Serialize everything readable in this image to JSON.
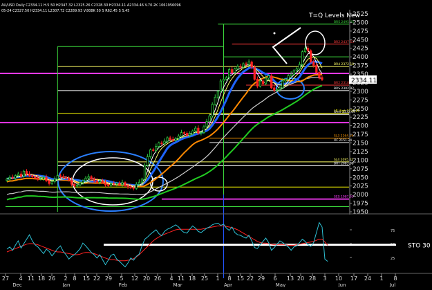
{
  "window": {
    "info_line_1": "AU/USD Daily C2334.11 H.5.50 H2347.32 L2325.26 C2328.30 H2334.11 A2334.46 V.70.2K 1061956096",
    "info_line_2": "05-24 C2327.50 H2334.11 L2307.72 C2289.93 V.808K 50 S R62.45 S S.45",
    "title": "T=Q Levels New"
  },
  "chart_data": [
    {
      "type": "line",
      "subtype": "candlestick",
      "title": "T=Q Levels New",
      "ylim": [
        1950,
        2525
      ],
      "y_ticks": [
        2525,
        2500,
        2475,
        2450,
        2425,
        2400,
        2375,
        2350,
        2325,
        2300,
        2275,
        2250,
        2225,
        2200,
        2175,
        2150,
        2125,
        2100,
        2075,
        2050,
        2025,
        2000,
        1975,
        1950
      ],
      "last_price": 2334.11,
      "x_tick_labels": [
        "27",
        "4",
        "11",
        "18",
        "26",
        "2",
        "8",
        "15",
        "22",
        "29",
        "5",
        "12",
        "20",
        "26",
        "4",
        "11",
        "18",
        "25",
        "1",
        "8",
        "15",
        "22",
        "29",
        "6",
        "13",
        "20",
        "28",
        "3",
        "10",
        "17",
        "24",
        "1",
        "8"
      ],
      "month_labels": [
        "Dec",
        "Jan",
        "Feb",
        "Mar",
        "Apr",
        "May",
        "Jun",
        "Jul"
      ],
      "series": [
        {
          "values": [
            2045,
            2050,
            2048,
            2055,
            2060,
            2053,
            2068,
            2060,
            2055,
            2052,
            2048,
            2045,
            2046,
            2050,
            2040,
            2032,
            2038,
            2045,
            2055,
            2052,
            2050,
            2048,
            2042,
            2030,
            2025,
            2028,
            2035,
            2040,
            2048,
            2052,
            2045,
            2040,
            2036,
            2040,
            2035,
            2028,
            2026,
            2032,
            2030,
            2033,
            2029,
            2035,
            2026,
            2022,
            2020,
            2018,
            2030,
            2036,
            2045,
            2085,
            2110,
            2130,
            2128,
            2140,
            2150,
            2148,
            2155,
            2165,
            2160,
            2158,
            2163,
            2170,
            2180,
            2178,
            2172,
            2176,
            2185,
            2193,
            2178,
            2180,
            2197,
            2212,
            2228,
            2262,
            2283,
            2300,
            2330,
            2335,
            2340,
            2363,
            2355,
            2365,
            2372,
            2370,
            2380,
            2378,
            2385,
            2370,
            2335,
            2315,
            2330,
            2322,
            2338,
            2345,
            2310,
            2303,
            2305,
            2310,
            2330,
            2335,
            2345,
            2350,
            2360,
            2365,
            2378,
            2415,
            2425,
            2418,
            2385,
            2375,
            2355,
            2340,
            2334
          ]
        },
        {
          "name": "8",
          "values": []
        },
        {
          "name": "20",
          "values": []
        },
        {
          "name": "50",
          "values": []
        },
        {
          "name": "100",
          "values": []
        },
        {
          "name": "200",
          "values": []
        }
      ],
      "levels": [
        {
          "label": "BRS 2495.45",
          "value": 2495,
          "color": "#3bd63b"
        },
        {
          "label": "BR2 2437.53",
          "value": 2437,
          "color": "#ff3b3b"
        },
        {
          "label": "BR4 2372.18",
          "value": 2372,
          "color": "#ffff66"
        },
        {
          "label": "",
          "value": 2352,
          "color": "#ff3bff"
        },
        {
          "label": "BR2 2318.35",
          "value": 2318,
          "color": "#ff3b3b"
        },
        {
          "label": "BRS 2302.92",
          "value": 2302,
          "color": "#ffffff"
        },
        {
          "label": "LB High 2236.89",
          "value": 2236,
          "color": "#ffff00"
        },
        {
          "label": "Over 2232.69",
          "value": 2233,
          "color": "#ffffff"
        },
        {
          "label": "",
          "value": 2209,
          "color": "#ff3bff"
        },
        {
          "label": "SL3 2164.66",
          "value": 2164,
          "color": "#ff9900"
        },
        {
          "label": "OF 2151.24",
          "value": 2151,
          "color": "#ffffff"
        },
        {
          "label": "SL4 2095.22",
          "value": 2095,
          "color": "#ffff66"
        },
        {
          "label": "BRT 2083.98",
          "value": 2084,
          "color": "#ffffff"
        },
        {
          "label": "",
          "value": 2022,
          "color": "#ffff00"
        },
        {
          "label": "SES 1987.63",
          "value": 1987,
          "color": "#ff3bff"
        }
      ]
    },
    {
      "type": "line",
      "subtype": "stochastic",
      "label": "STO 30",
      "ylim": [
        0,
        100
      ],
      "y_ticks": [
        75,
        50,
        25
      ],
      "series": [
        {
          "name": "%K",
          "values": [
            40,
            44,
            38,
            47,
            55,
            42,
            50,
            58,
            66,
            55,
            48,
            44,
            38,
            32,
            40,
            36,
            28,
            34,
            41,
            46,
            36,
            30,
            22,
            27,
            30,
            35,
            41,
            51,
            46,
            40,
            34,
            30,
            24,
            30,
            21,
            12,
            20,
            29,
            31,
            22,
            18,
            13,
            8,
            15,
            24,
            20,
            27,
            31,
            46,
            58,
            62,
            67,
            71,
            75,
            68,
            64,
            72,
            76,
            78,
            81,
            84,
            80,
            74,
            70,
            69,
            76,
            82,
            78,
            72,
            70,
            74,
            78,
            80,
            84,
            86,
            87,
            83,
            85,
            78,
            74,
            80,
            70,
            66,
            65,
            62,
            60,
            65,
            55,
            43,
            41,
            48,
            54,
            60,
            52,
            38,
            43,
            49,
            55,
            52,
            48,
            44,
            38,
            44,
            46,
            52,
            58,
            54,
            48,
            45,
            52,
            70,
            88,
            80,
            22,
            18
          ]
        },
        {
          "name": "%D",
          "values": [
            35,
            37,
            39,
            41,
            43,
            45,
            47,
            49,
            50,
            50,
            49,
            48,
            46,
            44,
            42,
            40,
            38,
            36,
            35,
            35,
            34,
            33,
            32,
            31,
            30,
            30,
            31,
            33,
            34,
            34,
            33,
            32,
            30,
            28,
            26,
            24,
            22,
            21,
            21,
            20,
            19,
            19,
            19,
            20,
            21,
            23,
            26,
            30,
            35,
            40,
            45,
            50,
            55,
            59,
            62,
            65,
            67,
            69,
            71,
            73,
            75,
            76,
            76,
            76,
            76,
            76,
            76,
            76,
            76,
            76,
            77,
            78,
            79,
            80,
            81,
            82,
            82,
            82,
            81,
            80,
            79,
            77,
            75,
            72,
            69,
            66,
            63,
            60,
            57,
            54,
            52,
            51,
            51,
            50,
            49,
            48,
            48,
            48,
            48,
            48,
            47,
            47,
            47,
            48,
            49,
            50,
            51,
            52,
            53,
            54,
            56,
            58,
            58,
            53,
            47
          ]
        }
      ],
      "reference_line": 48
    }
  ],
  "colors": {
    "background": "#000000",
    "bull_candle": "#2ecc40",
    "bear_candle": "#ff2222",
    "ma8": "#ffffff",
    "ma20": "#1e64ff",
    "ma50": "#ff8800",
    "ma100": "#cccccc",
    "ma200": "#22cc22",
    "stoch_k": "#2ec2d6",
    "stoch_d": "#ff2222"
  }
}
